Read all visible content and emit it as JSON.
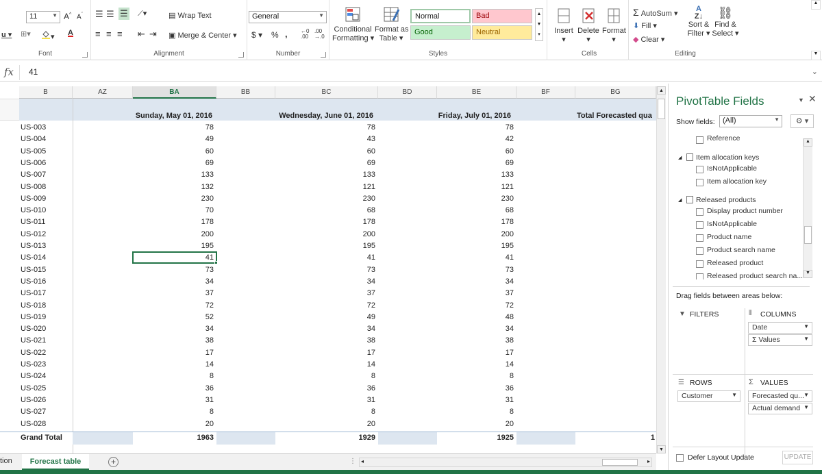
{
  "ribbon": {
    "font_size": "11",
    "font_group_label": "Font",
    "alignment_group_label": "Alignment",
    "wrap_text": "Wrap Text",
    "merge_center": "Merge & Center",
    "number_format": "General",
    "number_group_label": "Number",
    "currency": "$",
    "percent": "%",
    "comma": ",",
    "conditional_formatting": "Conditional",
    "conditional_formatting_2": "Formatting",
    "format_as_table": "Format as",
    "format_as_table_2": "Table",
    "styles_group_label": "Styles",
    "styles": {
      "normal": "Normal",
      "bad": "Bad",
      "good": "Good",
      "neutral": "Neutral"
    },
    "insert": "Insert",
    "delete": "Delete",
    "format": "Format",
    "cells_group_label": "Cells",
    "autosum": "AutoSum",
    "fill": "Fill",
    "clear": "Clear",
    "sort_filter": "Sort &",
    "sort_filter_2": "Filter",
    "find_select": "Find &",
    "find_select_2": "Select",
    "editing_group_label": "Editing"
  },
  "formula_bar": {
    "fx": "fx",
    "value": "41"
  },
  "columns": [
    "B",
    "AZ",
    "BA",
    "BB",
    "BC",
    "BD",
    "BE",
    "BF",
    "BG"
  ],
  "pivot": {
    "headers": [
      "Sunday, May 01, 2016",
      "Wednesday, June 01, 2016",
      "Friday, July 01, 2016",
      "Total Forecasted qua"
    ],
    "rows": [
      {
        "customer": "US-003",
        "may": "78",
        "jun": "78",
        "jul": "78"
      },
      {
        "customer": "US-004",
        "may": "49",
        "jun": "43",
        "jul": "42"
      },
      {
        "customer": "US-005",
        "may": "60",
        "jun": "60",
        "jul": "60"
      },
      {
        "customer": "US-006",
        "may": "69",
        "jun": "69",
        "jul": "69"
      },
      {
        "customer": "US-007",
        "may": "133",
        "jun": "133",
        "jul": "133"
      },
      {
        "customer": "US-008",
        "may": "132",
        "jun": "121",
        "jul": "121"
      },
      {
        "customer": "US-009",
        "may": "230",
        "jun": "230",
        "jul": "230"
      },
      {
        "customer": "US-010",
        "may": "70",
        "jun": "68",
        "jul": "68"
      },
      {
        "customer": "US-011",
        "may": "178",
        "jun": "178",
        "jul": "178"
      },
      {
        "customer": "US-012",
        "may": "200",
        "jun": "200",
        "jul": "200"
      },
      {
        "customer": "US-013",
        "may": "195",
        "jun": "195",
        "jul": "195"
      },
      {
        "customer": "US-014",
        "may": "41",
        "jun": "41",
        "jul": "41"
      },
      {
        "customer": "US-015",
        "may": "73",
        "jun": "73",
        "jul": "73"
      },
      {
        "customer": "US-016",
        "may": "34",
        "jun": "34",
        "jul": "34"
      },
      {
        "customer": "US-017",
        "may": "37",
        "jun": "37",
        "jul": "37"
      },
      {
        "customer": "US-018",
        "may": "72",
        "jun": "72",
        "jul": "72"
      },
      {
        "customer": "US-019",
        "may": "52",
        "jun": "49",
        "jul": "48"
      },
      {
        "customer": "US-020",
        "may": "34",
        "jun": "34",
        "jul": "34"
      },
      {
        "customer": "US-021",
        "may": "38",
        "jun": "38",
        "jul": "38"
      },
      {
        "customer": "US-022",
        "may": "17",
        "jun": "17",
        "jul": "17"
      },
      {
        "customer": "US-023",
        "may": "14",
        "jun": "14",
        "jul": "14"
      },
      {
        "customer": "US-024",
        "may": "8",
        "jun": "8",
        "jul": "8"
      },
      {
        "customer": "US-025",
        "may": "36",
        "jun": "36",
        "jul": "36"
      },
      {
        "customer": "US-026",
        "may": "31",
        "jun": "31",
        "jul": "31"
      },
      {
        "customer": "US-027",
        "may": "8",
        "jun": "8",
        "jul": "8"
      },
      {
        "customer": "US-028",
        "may": "20",
        "jun": "20",
        "jul": "20"
      }
    ],
    "grand_total": {
      "label": "Grand Total",
      "may": "1963",
      "jun": "1929",
      "jul": "1925",
      "total": "1"
    }
  },
  "sheet_tabs": {
    "prev_tab": "tion",
    "active": "Forecast table",
    "add": "+"
  },
  "pane": {
    "title": "PivotTable Fields",
    "show_fields_label": "Show fields:",
    "show_fields_value": "(All)",
    "tree": {
      "reference": "Reference",
      "item_alloc_group": "Item allocation keys",
      "item_alloc_fields": [
        "IsNotApplicable",
        "Item allocation key"
      ],
      "released_group": "Released products",
      "released_fields": [
        "Display product number",
        "IsNotApplicable",
        "Product name",
        "Product search name",
        "Released product",
        "Released product search na..."
      ]
    },
    "drag_hint": "Drag fields between areas below:",
    "filters_label": "FILTERS",
    "columns_label": "COLUMNS",
    "columns_items": [
      "Date",
      "Σ Values"
    ],
    "rows_label": "ROWS",
    "rows_items": [
      "Customer"
    ],
    "values_label": "VALUES",
    "values_items": [
      "Forecasted qu...",
      "Actual demand"
    ],
    "defer_label": "Defer Layout Update",
    "update_label": "UPDATE"
  },
  "colors": {
    "accent": "#217346",
    "pivot_header": "#dde6f0"
  }
}
